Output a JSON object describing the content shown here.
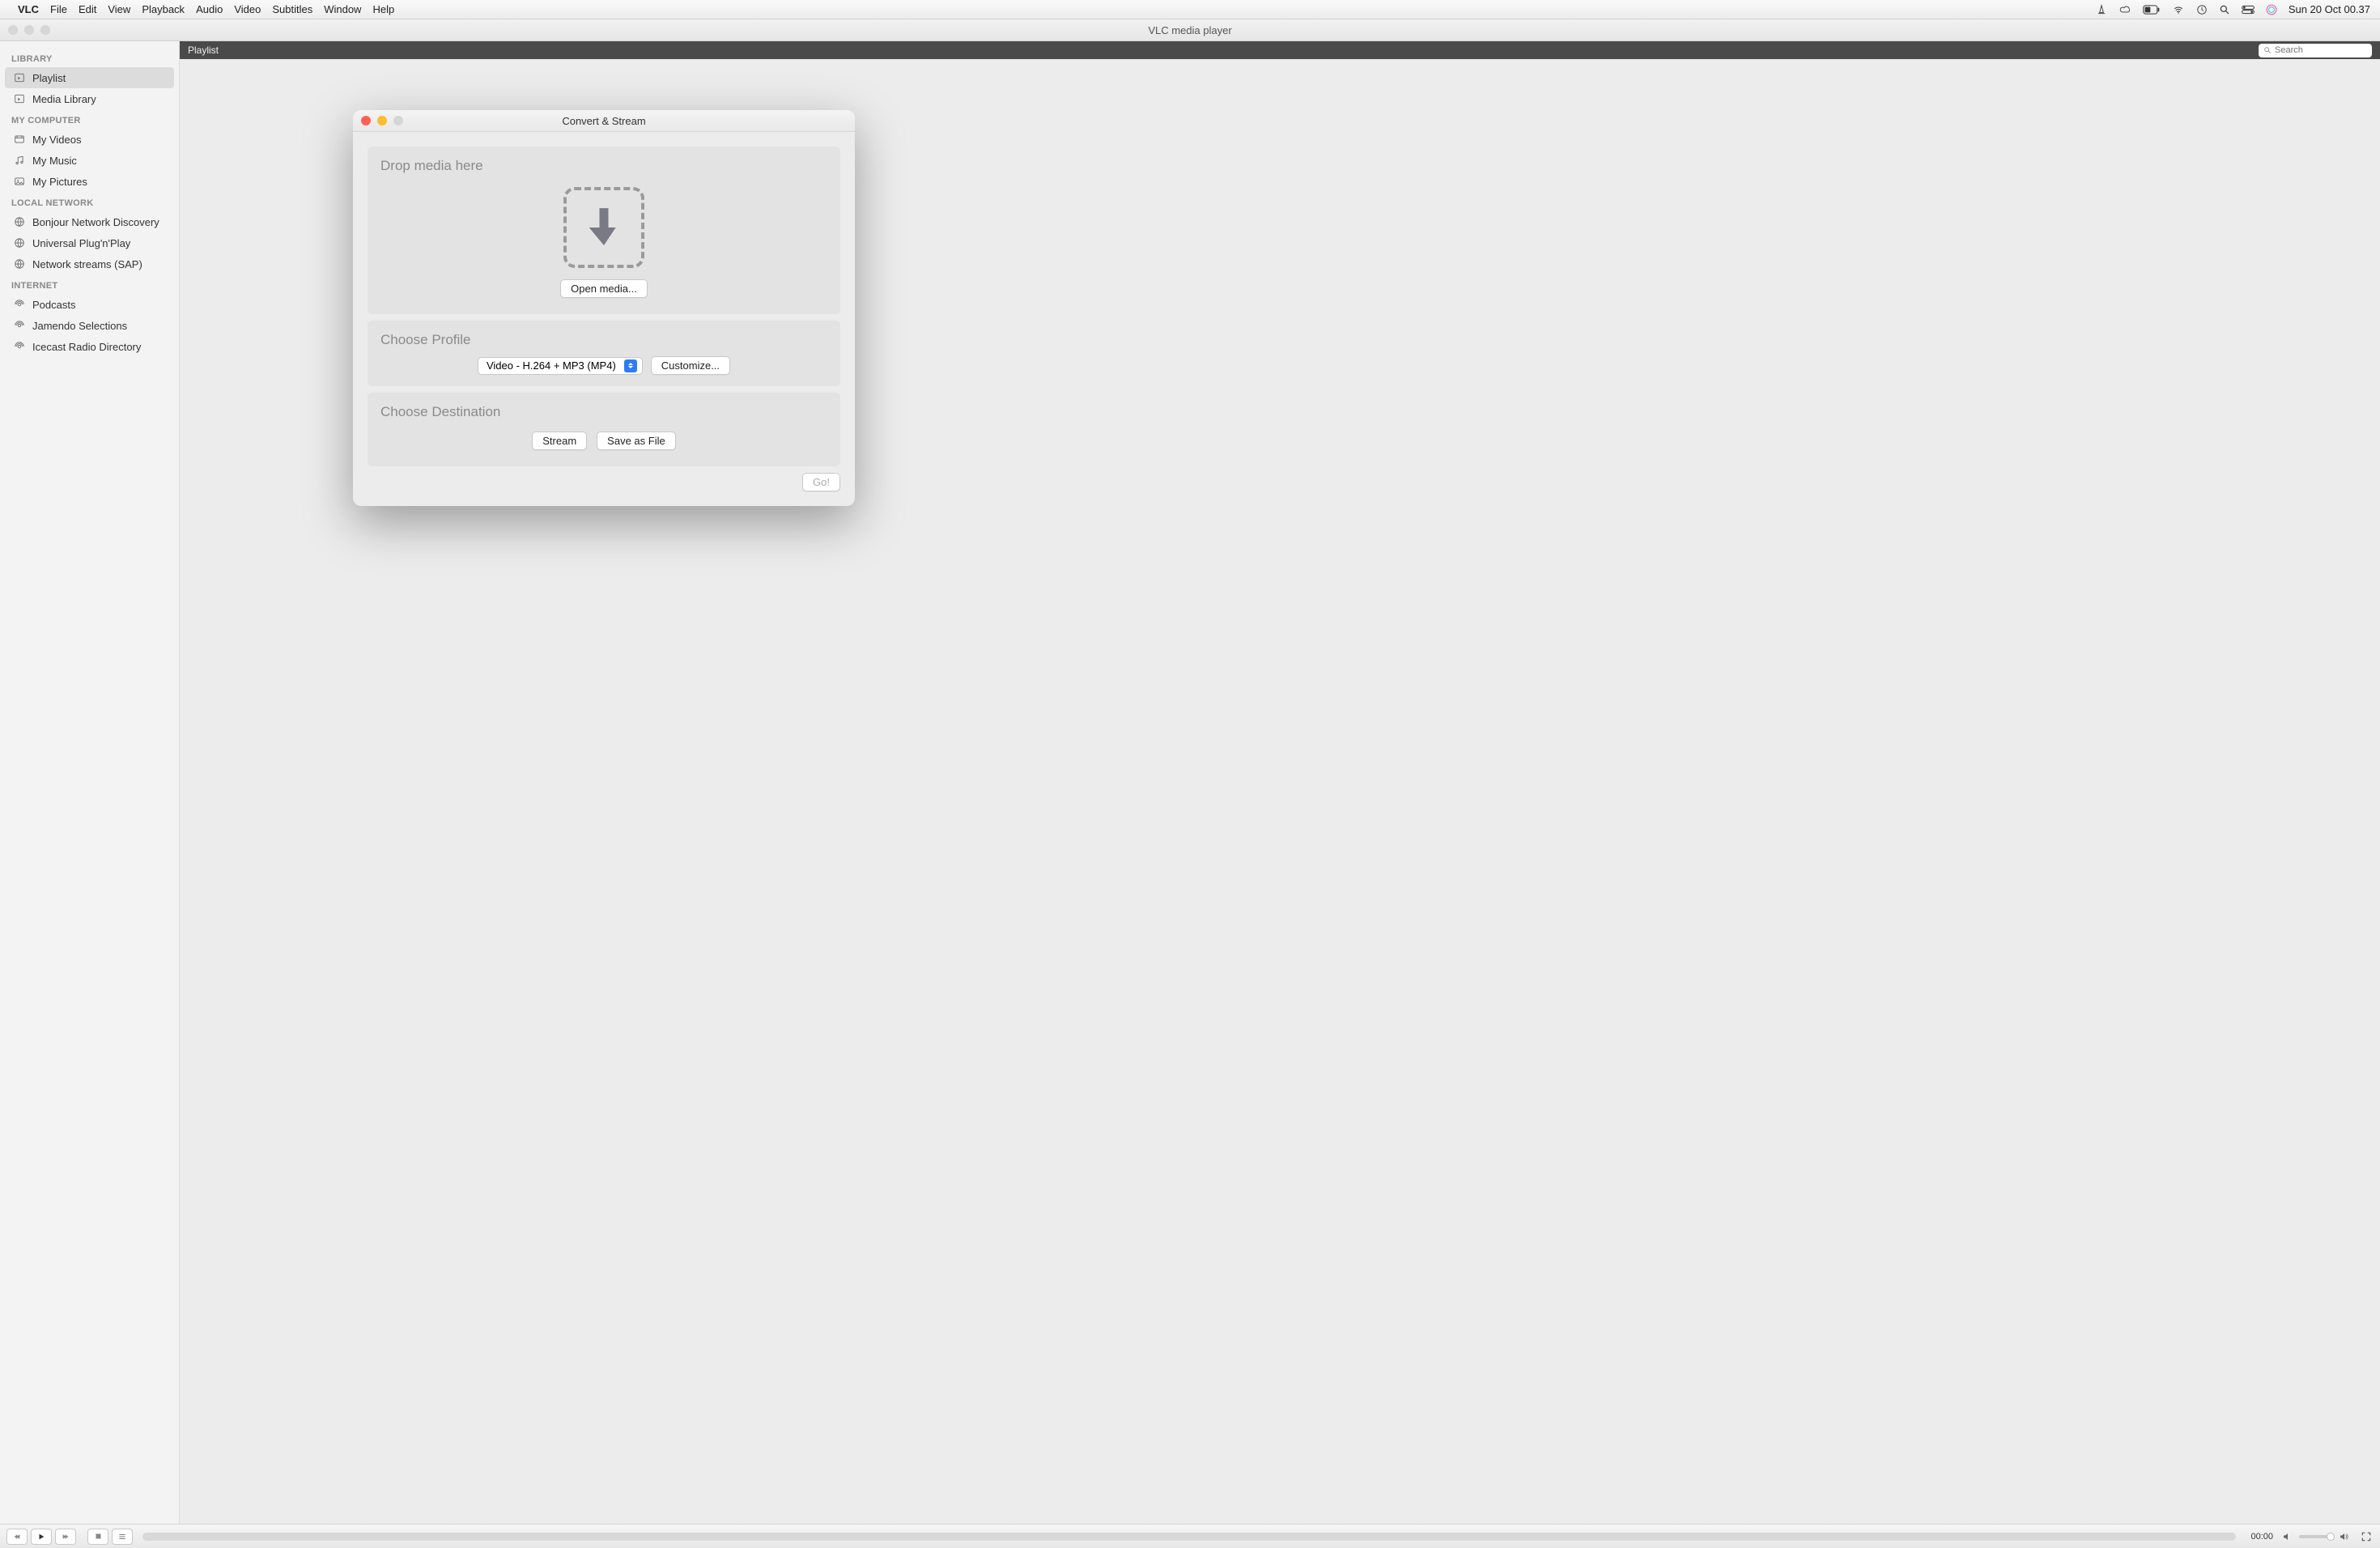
{
  "menubar": {
    "app_name": "VLC",
    "items": [
      "File",
      "Edit",
      "View",
      "Playback",
      "Audio",
      "Video",
      "Subtitles",
      "Window",
      "Help"
    ],
    "clock": "Sun 20 Oct  00.37"
  },
  "window": {
    "title": "VLC media player"
  },
  "sidebar": {
    "sections": [
      {
        "header": "LIBRARY",
        "items": [
          {
            "label": "Playlist",
            "icon": "playlist",
            "selected": true
          },
          {
            "label": "Media Library",
            "icon": "playlist",
            "selected": false
          }
        ]
      },
      {
        "header": "MY COMPUTER",
        "items": [
          {
            "label": "My Videos",
            "icon": "video"
          },
          {
            "label": "My Music",
            "icon": "music"
          },
          {
            "label": "My Pictures",
            "icon": "picture"
          }
        ]
      },
      {
        "header": "LOCAL NETWORK",
        "items": [
          {
            "label": "Bonjour Network Discovery",
            "icon": "globe"
          },
          {
            "label": "Universal Plug'n'Play",
            "icon": "globe"
          },
          {
            "label": "Network streams (SAP)",
            "icon": "globe"
          }
        ]
      },
      {
        "header": "INTERNET",
        "items": [
          {
            "label": "Podcasts",
            "icon": "podcast"
          },
          {
            "label": "Jamendo Selections",
            "icon": "podcast"
          },
          {
            "label": "Icecast Radio Directory",
            "icon": "podcast"
          }
        ]
      }
    ]
  },
  "playlist_header": {
    "title": "Playlist",
    "search_placeholder": "Search"
  },
  "playback": {
    "time": "00:00"
  },
  "dialog": {
    "title": "Convert & Stream",
    "drop_title": "Drop media here",
    "open_media": "Open media...",
    "profile_title": "Choose Profile",
    "profile_selected": "Video - H.264 + MP3 (MP4)",
    "customize": "Customize...",
    "destination_title": "Choose Destination",
    "stream": "Stream",
    "save_as_file": "Save as File",
    "go": "Go!"
  }
}
